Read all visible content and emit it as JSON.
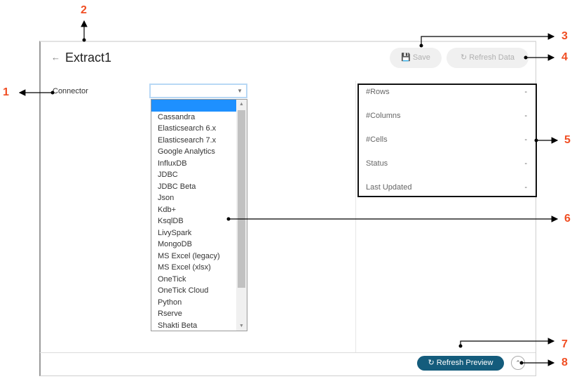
{
  "header": {
    "back_icon": "arrow-left-icon",
    "title": "Extract1"
  },
  "connector": {
    "label": "Connector",
    "value": "",
    "options": [
      "",
      "Cassandra",
      "Elasticsearch 6.x",
      "Elasticsearch 7.x",
      "Google Analytics",
      "InfluxDB",
      "JDBC",
      "JDBC Beta",
      "Json",
      "Kdb+",
      "KsqlDB",
      "LivySpark",
      "MongoDB",
      "MS Excel (legacy)",
      "MS Excel (xlsx)",
      "OneTick",
      "OneTick Cloud",
      "Python",
      "Rserve",
      "Shakti Beta"
    ]
  },
  "toolbar": {
    "save": "Save",
    "refresh_data": "Refresh Data"
  },
  "info": [
    {
      "label": "#Rows",
      "value": "-"
    },
    {
      "label": "#Columns",
      "value": "-"
    },
    {
      "label": "#Cells",
      "value": "-"
    },
    {
      "label": "Status",
      "value": "-"
    },
    {
      "label": "Last Updated",
      "value": "-"
    }
  ],
  "footer": {
    "refresh_preview": "Refresh Preview"
  },
  "annotations": [
    "1",
    "2",
    "3",
    "4",
    "5",
    "6",
    "7",
    "8"
  ],
  "colors": {
    "annotation": "#f04e23",
    "primary": "#145c7c",
    "highlight": "#1e90ff"
  }
}
